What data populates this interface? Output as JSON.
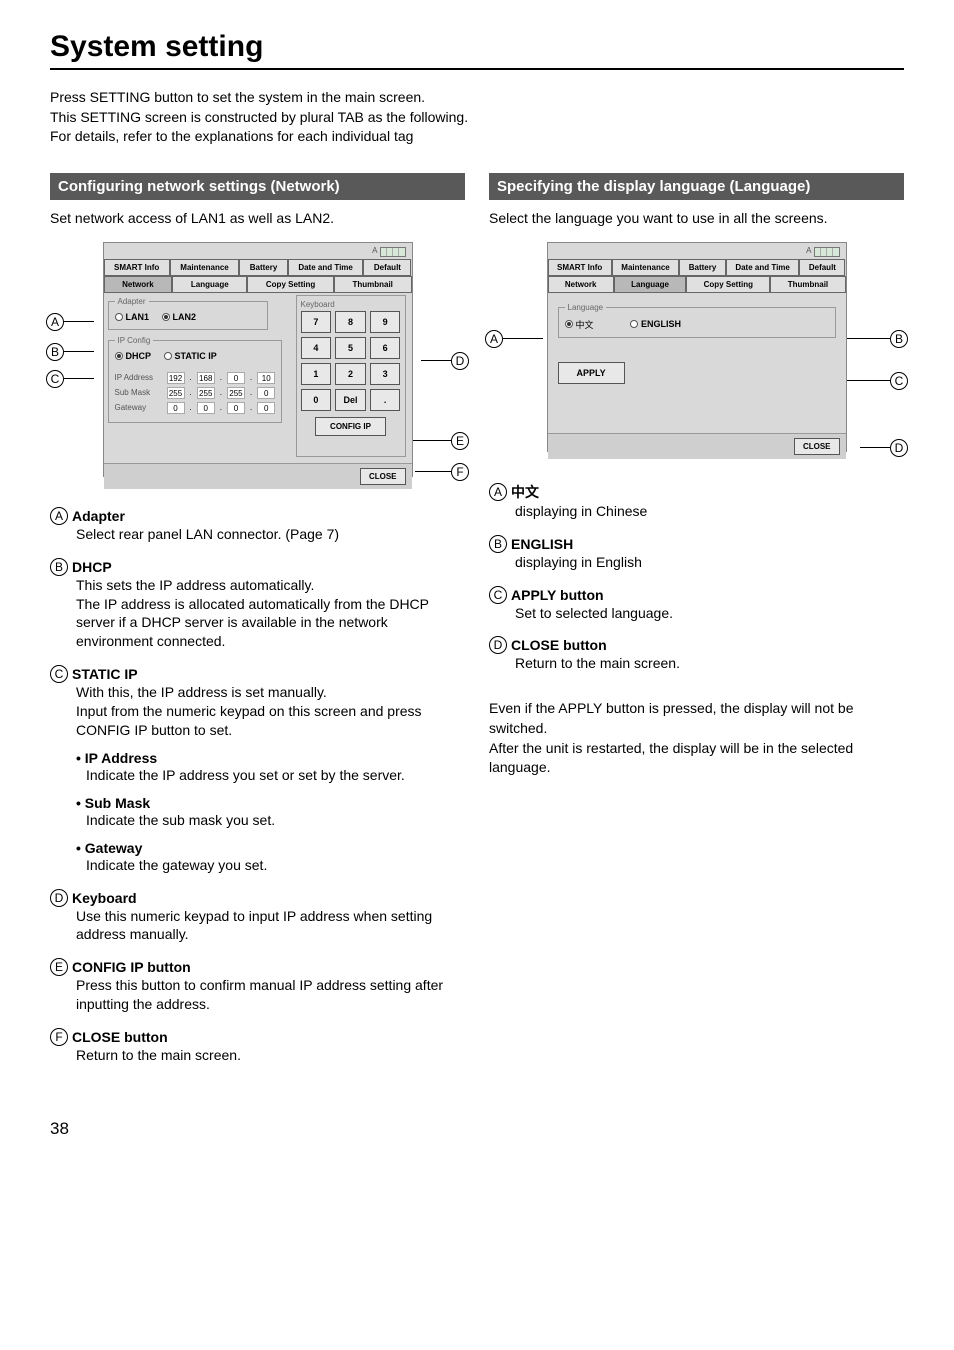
{
  "page_title": "System setting",
  "page_number": "38",
  "intro": [
    "Press SETTING button to set the system in the main screen.",
    "This SETTING screen is constructed by plural TAB as the following.",
    "For details, refer to the explanations for each individual tag"
  ],
  "left": {
    "heading": "Configuring network settings (Network)",
    "lead": "Set network access of LAN1 as well as LAN2.",
    "shot": {
      "tabs_row1": [
        "SMART Info",
        "Maintenance",
        "Battery",
        "Date and Time",
        "Default"
      ],
      "tabs_row2": [
        "Network",
        "Language",
        "Copy Setting",
        "Thumbnail"
      ],
      "active_tab": "Network",
      "adapter_label": "Adapter",
      "lan1": "LAN1",
      "lan2": "LAN2",
      "ipconfig_label": "IP Config",
      "dhcp": "DHCP",
      "staticip": "STATIC IP",
      "ip_address_label": "IP Address",
      "sub_mask_label": "Sub Mask",
      "gateway_label": "Gateway",
      "ip_address": [
        "192",
        "168",
        "0",
        "10"
      ],
      "sub_mask": [
        "255",
        "255",
        "255",
        "0"
      ],
      "gateway": [
        "0",
        "0",
        "0",
        "0"
      ],
      "keypad_label": "Keyboard",
      "keys": [
        "7",
        "8",
        "9",
        "4",
        "5",
        "6",
        "1",
        "2",
        "3",
        "0",
        "Del",
        "."
      ],
      "config_ip": "CONFIG IP",
      "close": "CLOSE",
      "power_label": "A"
    },
    "callouts": {
      "A": {
        "title": "Adapter",
        "body": "Select rear panel LAN connector. (Page 7)"
      },
      "B": {
        "title": "DHCP",
        "body": "This sets the IP address automatically.\nThe IP address is allocated automatically from the DHCP server if a DHCP server is available in the network environment connected."
      },
      "C": {
        "title": "STATIC IP",
        "body": "With this, the IP address is set manually.\nInput from the numeric keypad on this screen and press CONFIG IP button to set."
      },
      "C_subs": [
        {
          "title": "• IP Address",
          "body": "Indicate the IP address you set or set by the server."
        },
        {
          "title": "• Sub Mask",
          "body": "Indicate the sub mask you set."
        },
        {
          "title": "• Gateway",
          "body": "Indicate the gateway you set."
        }
      ],
      "D": {
        "title": "Keyboard",
        "body": "Use this numeric keypad to input IP address when setting address manually."
      },
      "E": {
        "title": "CONFIG IP button",
        "body": "Press this button to confirm manual IP address setting after inputting the address."
      },
      "F": {
        "title": "CLOSE button",
        "body": "Return to the main screen."
      }
    }
  },
  "right": {
    "heading": "Specifying the display language (Language)",
    "lead": "Select the language you want to use in all the screens.",
    "shot": {
      "tabs_row1": [
        "SMART Info",
        "Maintenance",
        "Battery",
        "Date and Time",
        "Default"
      ],
      "tabs_row2": [
        "Network",
        "Language",
        "Copy Setting",
        "Thumbnail"
      ],
      "active_tab": "Language",
      "group_label": "Language",
      "chinese": "中文",
      "english": "ENGLISH",
      "apply": "APPLY",
      "close": "CLOSE",
      "power_label": "A"
    },
    "callouts": {
      "A": {
        "title": "中文",
        "body": "displaying in Chinese"
      },
      "B": {
        "title": "ENGLISH",
        "body": "displaying in English"
      },
      "C": {
        "title": "APPLY button",
        "body": "Set to selected language."
      },
      "D": {
        "title": "CLOSE button",
        "body": "Return to the main screen."
      }
    },
    "note": "Even if the APPLY button is pressed, the display will not be switched.\nAfter the unit is restarted, the display will be in the selected language."
  }
}
